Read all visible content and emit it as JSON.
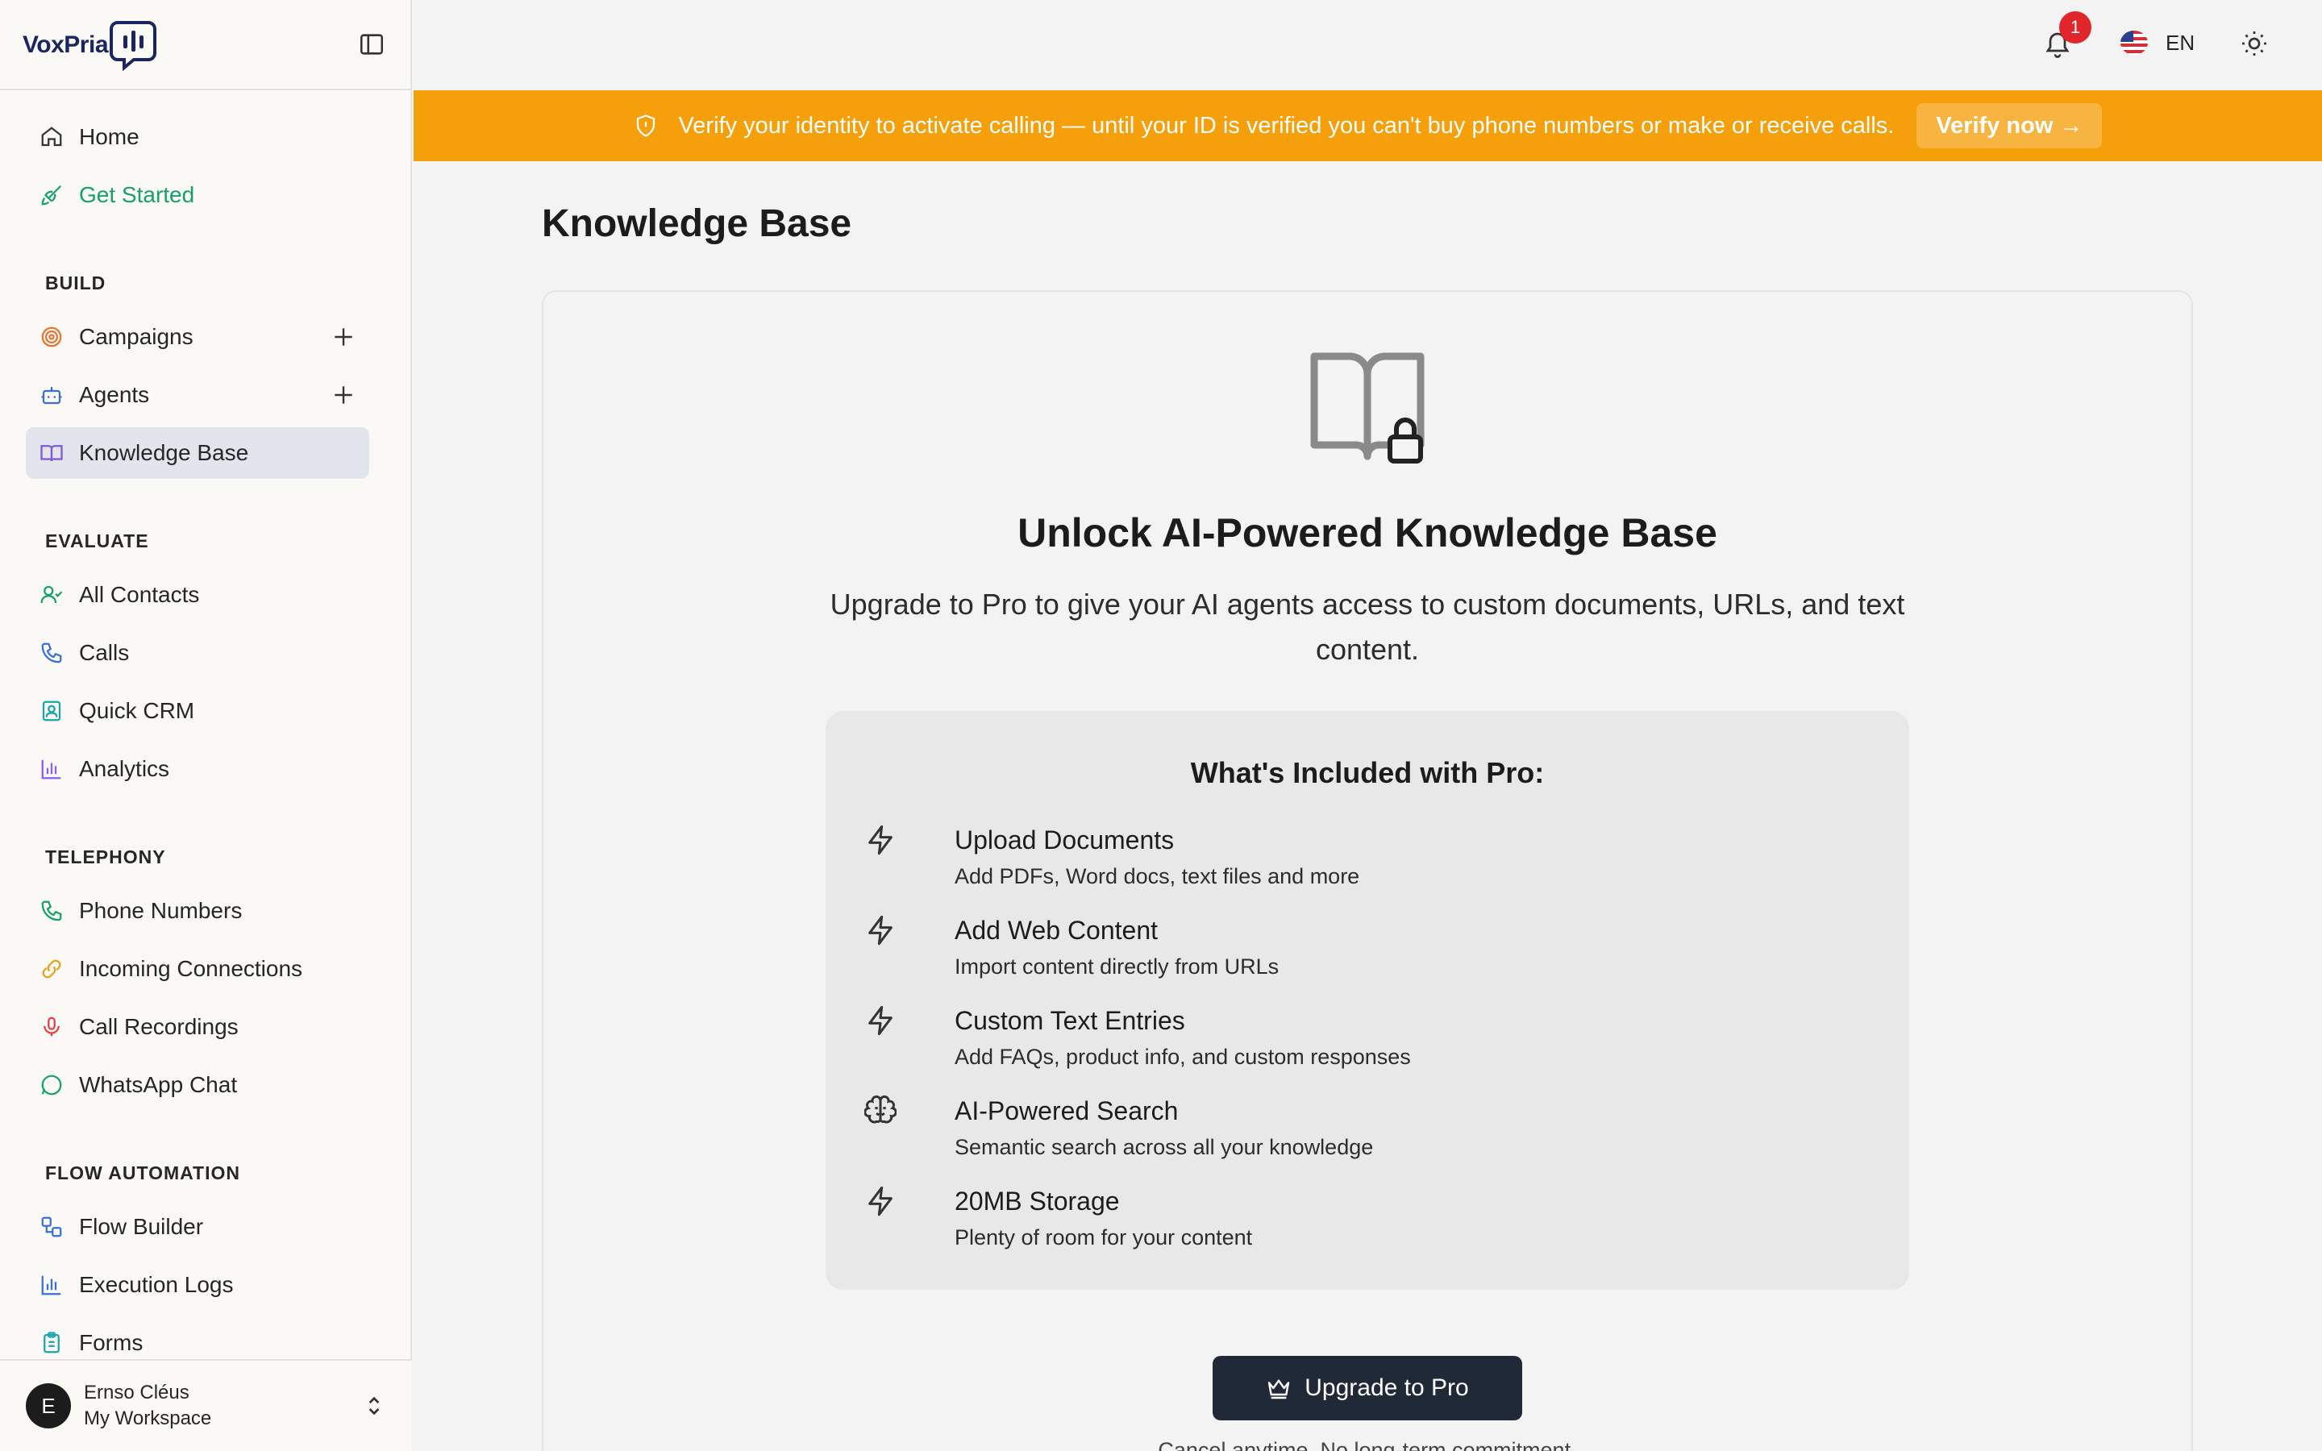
{
  "app": {
    "logo_text": "VoxPria"
  },
  "sidebar": {
    "items": [
      {
        "label": "Home"
      },
      {
        "label": "Get Started"
      },
      {
        "label": "Campaigns"
      },
      {
        "label": "Agents"
      },
      {
        "label": "Knowledge Base"
      },
      {
        "label": "All Contacts"
      },
      {
        "label": "Calls"
      },
      {
        "label": "Quick CRM"
      },
      {
        "label": "Analytics"
      },
      {
        "label": "Phone Numbers"
      },
      {
        "label": "Incoming Connections"
      },
      {
        "label": "Call Recordings"
      },
      {
        "label": "WhatsApp Chat"
      },
      {
        "label": "Flow Builder"
      },
      {
        "label": "Execution Logs"
      },
      {
        "label": "Forms"
      }
    ],
    "sections": {
      "build": "BUILD",
      "evaluate": "EVALUATE",
      "telephony": "TELEPHONY",
      "flow": "FLOW AUTOMATION"
    },
    "user": {
      "initial": "E",
      "name": "Ernso Cléus",
      "workspace": "My Workspace"
    }
  },
  "topbar": {
    "notification_count": "1",
    "language": "EN"
  },
  "banner": {
    "message": "Verify your identity to activate calling — until your ID is verified you can't buy phone numbers or make or receive calls.",
    "button": "Verify now →"
  },
  "main": {
    "title": "Knowledge Base",
    "hero_title": "Unlock AI-Powered Knowledge Base",
    "hero_subtitle": "Upgrade to Pro to give your AI agents access to custom documents, URLs, and text content.",
    "pro_title": "What's Included with Pro:",
    "features": [
      {
        "title": "Upload Documents",
        "desc": "Add PDFs, Word docs, text files and more",
        "icon": "zap-icon"
      },
      {
        "title": "Add Web Content",
        "desc": "Import content directly from URLs",
        "icon": "zap-icon"
      },
      {
        "title": "Custom Text Entries",
        "desc": "Add FAQs, product info, and custom responses",
        "icon": "zap-icon"
      },
      {
        "title": "AI-Powered Search",
        "desc": "Semantic search across all your knowledge",
        "icon": "brain-icon"
      },
      {
        "title": "20MB Storage",
        "desc": "Plenty of room for your content",
        "icon": "zap-icon"
      }
    ],
    "upgrade_button": "Upgrade to Pro",
    "footnote": "Cancel anytime. No long-term commitment."
  },
  "colors": {
    "banner": "#f59f0b",
    "accent_green": "#16a06a",
    "button_dark": "#1f2937",
    "badge": "#e0252b"
  }
}
